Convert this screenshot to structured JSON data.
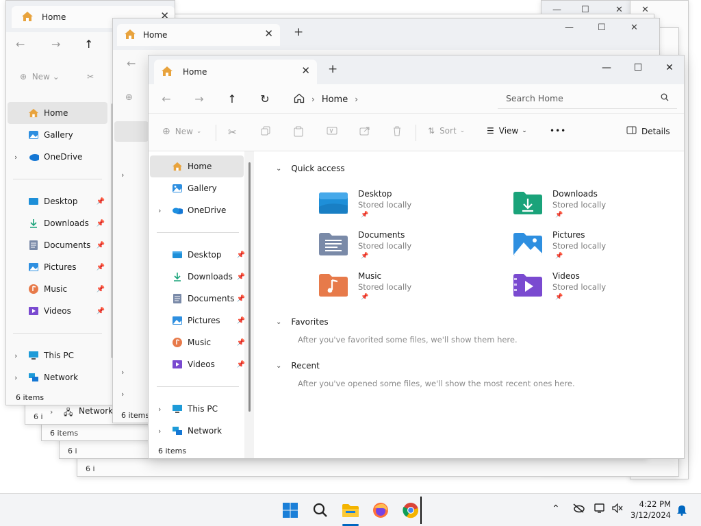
{
  "colors": {
    "accent": "#0067c0",
    "folder_desktop": "#1e8fd8",
    "folder_downloads": "#1aa37a",
    "folder_docs": "#7a8aa8",
    "folder_pictures": "#2e8fe0",
    "folder_music": "#e77a4a",
    "folder_videos": "#7a4ad0",
    "selected_bg": "#e5e5e5"
  },
  "window": {
    "tab_title": "Home",
    "controls": {
      "minimize": "—",
      "maximize": "☐",
      "close": "✕"
    },
    "new_tab": "+",
    "breadcrumb": [
      "Home"
    ],
    "search_placeholder": "Search Home",
    "commands": {
      "new": "New",
      "sort": "Sort",
      "view": "View",
      "more": "•••",
      "details": "Details"
    },
    "status": "6 items"
  },
  "sidebar": {
    "top": [
      {
        "label": "Home",
        "icon": "home-icon",
        "selected": true
      },
      {
        "label": "Gallery",
        "icon": "gallery-icon"
      },
      {
        "label": "OneDrive",
        "icon": "onedrive-icon",
        "expandable": true
      }
    ],
    "pinned": [
      {
        "label": "Desktop",
        "icon": "desktop-folder-icon"
      },
      {
        "label": "Downloads",
        "icon": "downloads-icon"
      },
      {
        "label": "Documents",
        "icon": "documents-icon"
      },
      {
        "label": "Pictures",
        "icon": "pictures-icon"
      },
      {
        "label": "Music",
        "icon": "music-icon"
      },
      {
        "label": "Videos",
        "icon": "videos-icon"
      }
    ],
    "bottom": [
      {
        "label": "This PC",
        "icon": "this-pc-icon"
      },
      {
        "label": "Network",
        "icon": "network-icon"
      }
    ]
  },
  "content": {
    "quick_access": {
      "title": "Quick access",
      "items": [
        {
          "name": "Desktop",
          "sub": "Stored locally"
        },
        {
          "name": "Downloads",
          "sub": "Stored locally"
        },
        {
          "name": "Documents",
          "sub": "Stored locally"
        },
        {
          "name": "Pictures",
          "sub": "Stored locally"
        },
        {
          "name": "Music",
          "sub": "Stored locally"
        },
        {
          "name": "Videos",
          "sub": "Stored locally"
        }
      ]
    },
    "favorites": {
      "title": "Favorites",
      "note": "After you've favorited some files, we'll show them here."
    },
    "recent": {
      "title": "Recent",
      "note": "After you've opened some files, we'll show the most recent ones here."
    }
  },
  "background_windows": {
    "status": "6 items",
    "status_short": "6 i",
    "network_label": "Network"
  },
  "taskbar": {
    "time": "4:22 PM",
    "date": "3/12/2024"
  }
}
